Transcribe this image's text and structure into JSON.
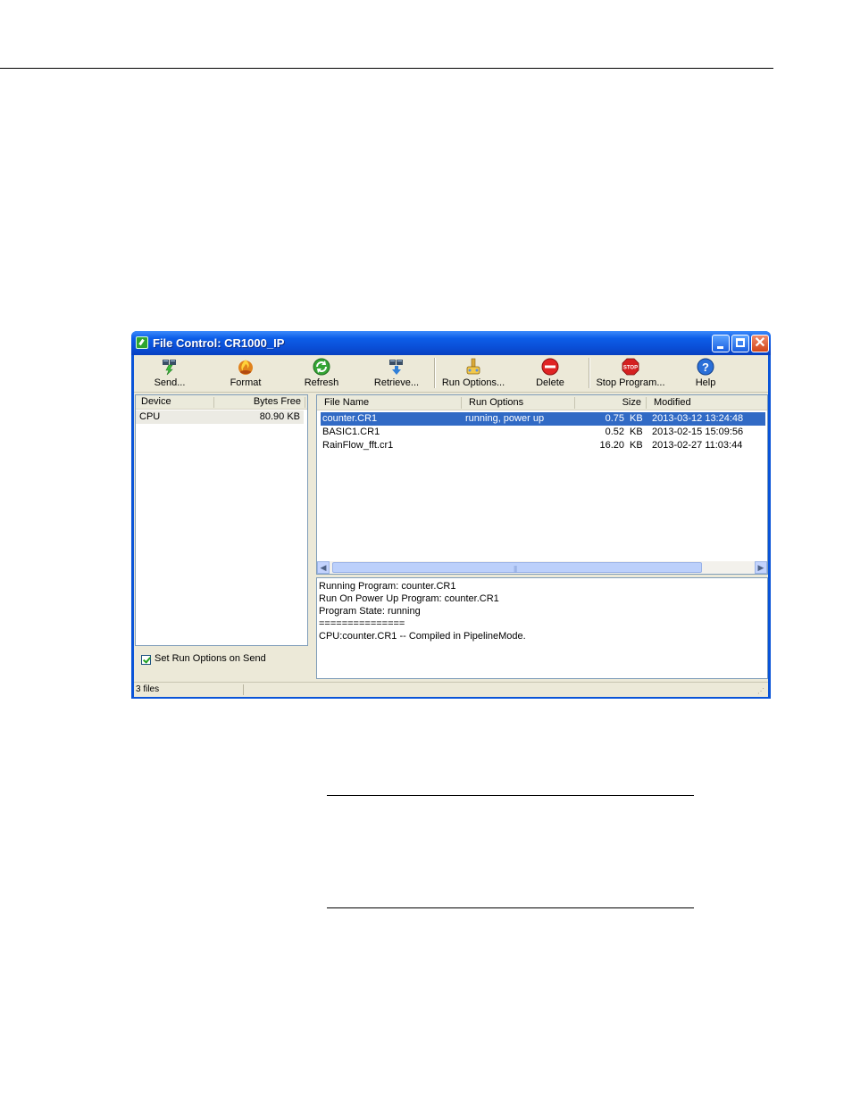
{
  "window": {
    "title": "File Control: CR1000_IP"
  },
  "toolbar": {
    "items": [
      {
        "label": "Send...",
        "icon": "send-icon"
      },
      {
        "label": "Format",
        "icon": "format-icon"
      },
      {
        "label": "Refresh",
        "icon": "refresh-icon"
      },
      {
        "label": "Retrieve...",
        "icon": "retrieve-icon"
      },
      {
        "label": "Run Options...",
        "icon": "run-options-icon"
      },
      {
        "label": "Delete",
        "icon": "delete-icon"
      },
      {
        "label": "Stop Program...",
        "icon": "stop-icon"
      },
      {
        "label": "Help",
        "icon": "help-icon"
      }
    ]
  },
  "devices": {
    "headers": {
      "device": "Device",
      "bytes_free": "Bytes Free"
    },
    "rows": [
      {
        "device": "CPU",
        "bytes_free": "80.90 KB"
      }
    ]
  },
  "files": {
    "headers": {
      "name": "File Name",
      "run_options": "Run Options",
      "size": "Size",
      "modified": "Modified"
    },
    "rows": [
      {
        "name": "counter.CR1",
        "run_options": "running, power up",
        "size": "0.75",
        "unit": "KB",
        "modified": "2013-03-12 13:24:48"
      },
      {
        "name": "BASIC1.CR1",
        "run_options": "",
        "size": "0.52",
        "unit": "KB",
        "modified": "2013-02-15 15:09:56"
      },
      {
        "name": "RainFlow_fft.cr1",
        "run_options": "",
        "size": "16.20",
        "unit": "KB",
        "modified": "2013-02-27 11:03:44"
      }
    ]
  },
  "options": {
    "set_run_options_label": "Set Run Options on Send",
    "set_run_options_checked": true
  },
  "log": {
    "lines": [
      "Running Program: counter.CR1",
      "Run On Power Up Program: counter.CR1",
      "Program State: running",
      "===============",
      "CPU:counter.CR1 -- Compiled in PipelineMode."
    ]
  },
  "status": {
    "text": "3 files"
  },
  "colors": {
    "title_bar": "#0a54d8",
    "selection": "#316ac5",
    "face": "#ece9d8"
  }
}
